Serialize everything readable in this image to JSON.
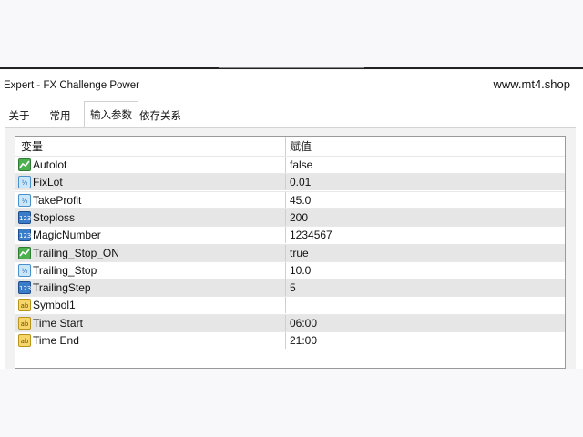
{
  "window": {
    "title": "Expert - FX Challenge Power",
    "watermark": "www.mt4.shop"
  },
  "tabs": [
    {
      "label": "关于",
      "active": false
    },
    {
      "label": "常用",
      "active": false
    },
    {
      "label": "输入参数",
      "active": true
    },
    {
      "label": "依存关系",
      "active": false
    }
  ],
  "grid": {
    "headers": {
      "name": "变量",
      "value": "赋值"
    },
    "rows": [
      {
        "type": "bool",
        "icon": "bool-param-icon",
        "name": "Autolot",
        "value": "false"
      },
      {
        "type": "dbl",
        "icon": "double-param-icon",
        "name": "FixLot",
        "value": "0.01"
      },
      {
        "type": "dbl",
        "icon": "double-param-icon",
        "name": "TakeProfit",
        "value": "45.0"
      },
      {
        "type": "int",
        "icon": "int-param-icon",
        "name": "Stoploss",
        "value": "200"
      },
      {
        "type": "int",
        "icon": "int-param-icon",
        "name": "MagicNumber",
        "value": "1234567"
      },
      {
        "type": "bool",
        "icon": "bool-param-icon",
        "name": "Trailing_Stop_ON",
        "value": "true"
      },
      {
        "type": "dbl",
        "icon": "double-param-icon",
        "name": "Trailing_Stop",
        "value": "10.0"
      },
      {
        "type": "int",
        "icon": "int-param-icon",
        "name": "TrailingStep",
        "value": "5"
      },
      {
        "type": "str",
        "icon": "string-param-icon",
        "name": "Symbol1",
        "value": ""
      },
      {
        "type": "str",
        "icon": "string-param-icon",
        "name": "Time Start",
        "value": "06:00"
      },
      {
        "type": "str",
        "icon": "string-param-icon",
        "name": "Time End",
        "value": "21:00"
      }
    ]
  },
  "colors": {
    "bool": "#4caf50",
    "double": "#c9e6fb",
    "int": "#3b7cc9",
    "string": "#f6d66a",
    "row_alt": "#e6e6e6"
  }
}
